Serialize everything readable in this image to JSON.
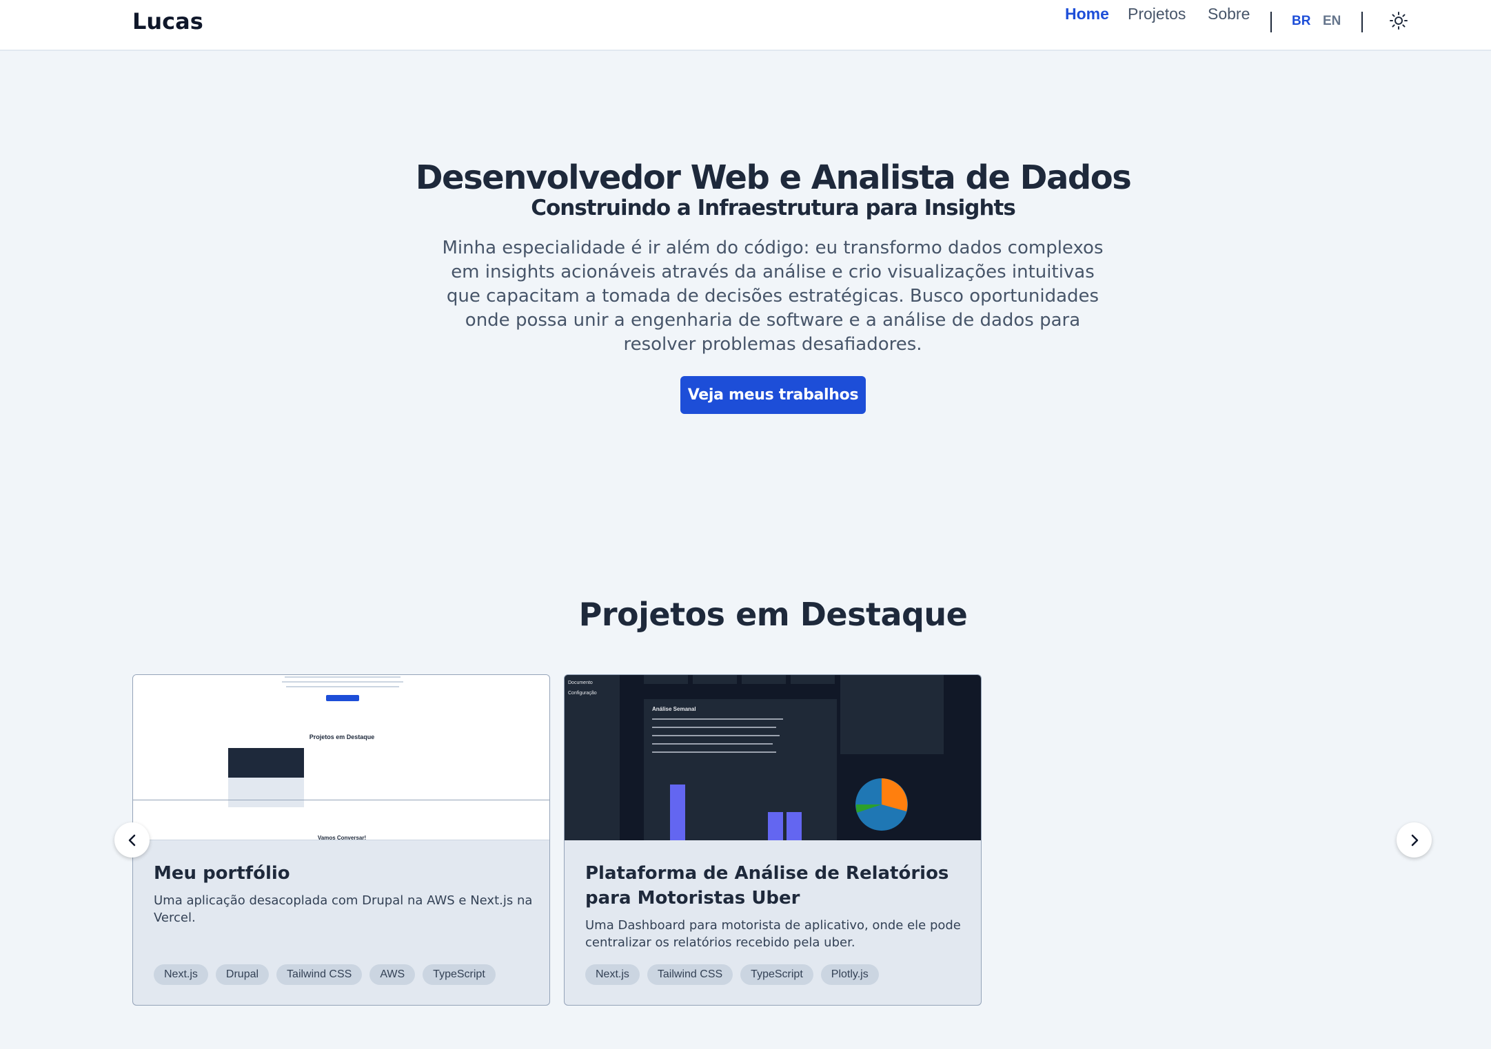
{
  "header": {
    "logo": "Lucas",
    "nav": {
      "home": "Home",
      "projetos": "Projetos",
      "sobre": "Sobre"
    },
    "lang": {
      "br": "BR",
      "en": "EN"
    },
    "theme_icon": "sun-icon"
  },
  "hero": {
    "title": "Desenvolvedor Web e Analista de Dados",
    "subtitle": "Construindo a Infraestrutura para Insights",
    "description": "Minha especialidade é ir além do código: eu transformo dados complexos em insights acionáveis através da análise e crio visualizações intuitivas que capacitam a tomada de decisões estratégicas. Busco oportunidades onde possa unir a engenharia de software e a análise de dados para resolver problemas desafiadores.",
    "cta": "Veja meus trabalhos"
  },
  "projects": {
    "title": "Projetos em Destaque",
    "prev_icon": "chevron-left-icon",
    "next_icon": "chevron-right-icon",
    "items": [
      {
        "title": "Meu portfólio",
        "description": "Uma aplicação desacoplada com Drupal na AWS e Next.js na Vercel.",
        "tags": [
          "Next.js",
          "Drupal",
          "Tailwind CSS",
          "AWS",
          "TypeScript"
        ],
        "thumb": {
          "section": "Projetos em Destaque",
          "footer": "Vamos Conversar!"
        }
      },
      {
        "title": "Plataforma de Análise de Relatórios para Motoristas Uber",
        "description": "Uma Dashboard para motorista de aplicativo, onde ele pode centralizar os relatórios recebido pela uber.",
        "tags": [
          "Next.js",
          "Tailwind CSS",
          "TypeScript",
          "Plotly.js"
        ],
        "thumb": {
          "side_1": "Documento",
          "side_2": "Configuração",
          "panel_title": "Análise Semanal"
        }
      }
    ]
  },
  "colors": {
    "accent": "#1d4ed8",
    "background": "#f1f5f9",
    "card": "#e2e8f0"
  }
}
